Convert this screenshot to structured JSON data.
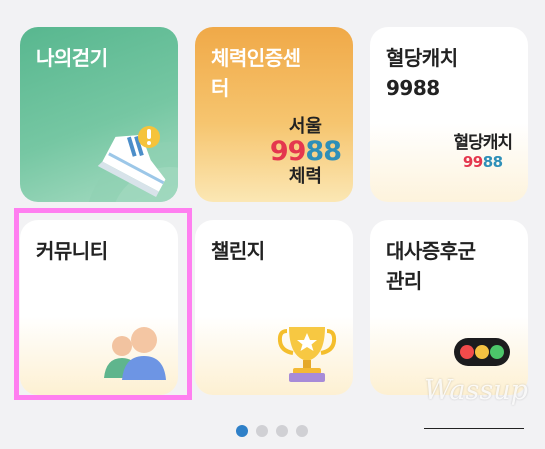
{
  "tiles": [
    {
      "label": "나의걷기",
      "icon": "walking-shoe-icon"
    },
    {
      "label": "체력인증센\n터",
      "logo": {
        "line1": "서울",
        "line2_a": "99",
        "line2_b": "88",
        "line3": "체력"
      }
    },
    {
      "label": "혈당캐치\n9988",
      "logo": {
        "line1": "혈당캐치",
        "line2_a": "99",
        "line2_b": "88"
      }
    },
    {
      "label": "커뮤니티",
      "icon": "community-people-icon"
    },
    {
      "label": "챌린지",
      "icon": "trophy-icon"
    },
    {
      "label": "대사증후군\n관리",
      "icon": "traffic-light-icon"
    }
  ],
  "pagination": {
    "total": 4,
    "active": 0
  },
  "watermark": "Wassup",
  "colors": {
    "highlight": "#ff7ff0",
    "walk_tile": "#58b78f",
    "fitness_tile": "#f0a948",
    "logo_red": "#e4374e",
    "logo_blue": "#2e8fb8",
    "active_dot": "#2f80c8"
  }
}
